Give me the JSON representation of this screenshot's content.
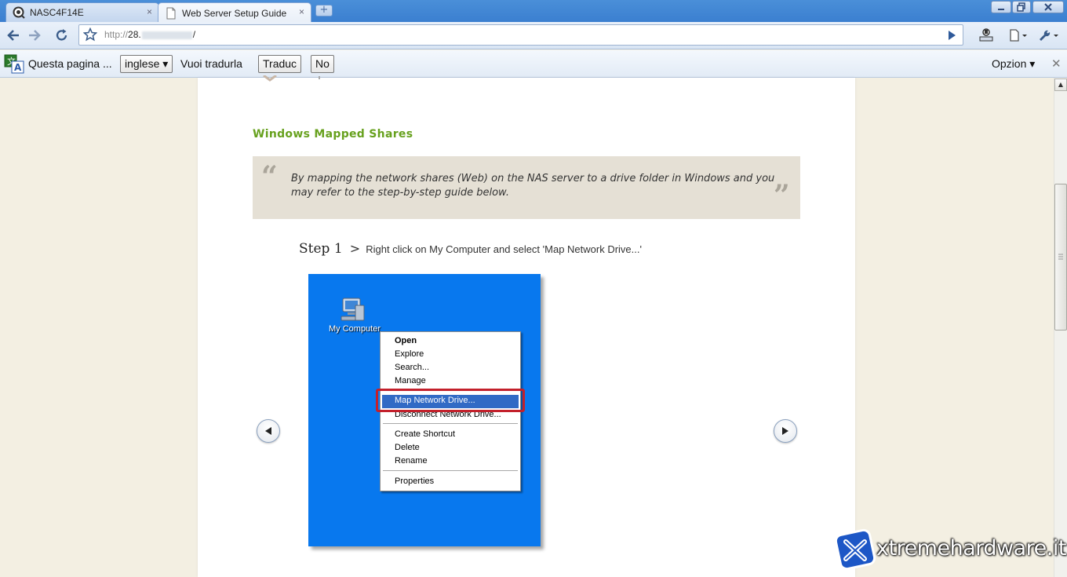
{
  "browser": {
    "tabs": [
      {
        "title": "NASC4F14E",
        "active": false
      },
      {
        "title": "Web Server Setup Guide",
        "active": true
      }
    ],
    "close_glyph": "×",
    "url_scheme": "http://",
    "url_host": "28.",
    "url_tail": "/"
  },
  "translate_bar": {
    "message": "Questa pagina ...",
    "language": "inglese ▾",
    "question": "Vuoi tradurla",
    "translate_label": "Traduc",
    "no_label": "No",
    "options_label": "Opzion ▾",
    "close_glyph": "✕"
  },
  "content": {
    "section_title": "Windows Mapped Shares",
    "quote": "By mapping the network shares (Web) on the NAS server to a drive folder in Windows and you may refer to the step-by-step guide below.",
    "quote_open": "“",
    "quote_close": "”",
    "step_label": "Step 1",
    "step_sep": ">",
    "step_text": "Right click on My Computer and select 'Map Network Drive...'"
  },
  "screenshot": {
    "icon_label": "My Computer",
    "menu": {
      "open": "Open",
      "explore": "Explore",
      "search": "Search...",
      "manage": "Manage",
      "map": "Map Network Drive...",
      "disconnect": "Disconnect Network Drive...",
      "shortcut": "Create Shortcut",
      "delete": "Delete",
      "rename": "Rename",
      "properties": "Properties"
    }
  },
  "watermark": {
    "text": "xtremehardware.it"
  },
  "colors": {
    "section_title": "#67a11e",
    "xp_desktop": "#0878ee",
    "highlight": "#c3202b",
    "menu_selected": "#316ac5"
  }
}
